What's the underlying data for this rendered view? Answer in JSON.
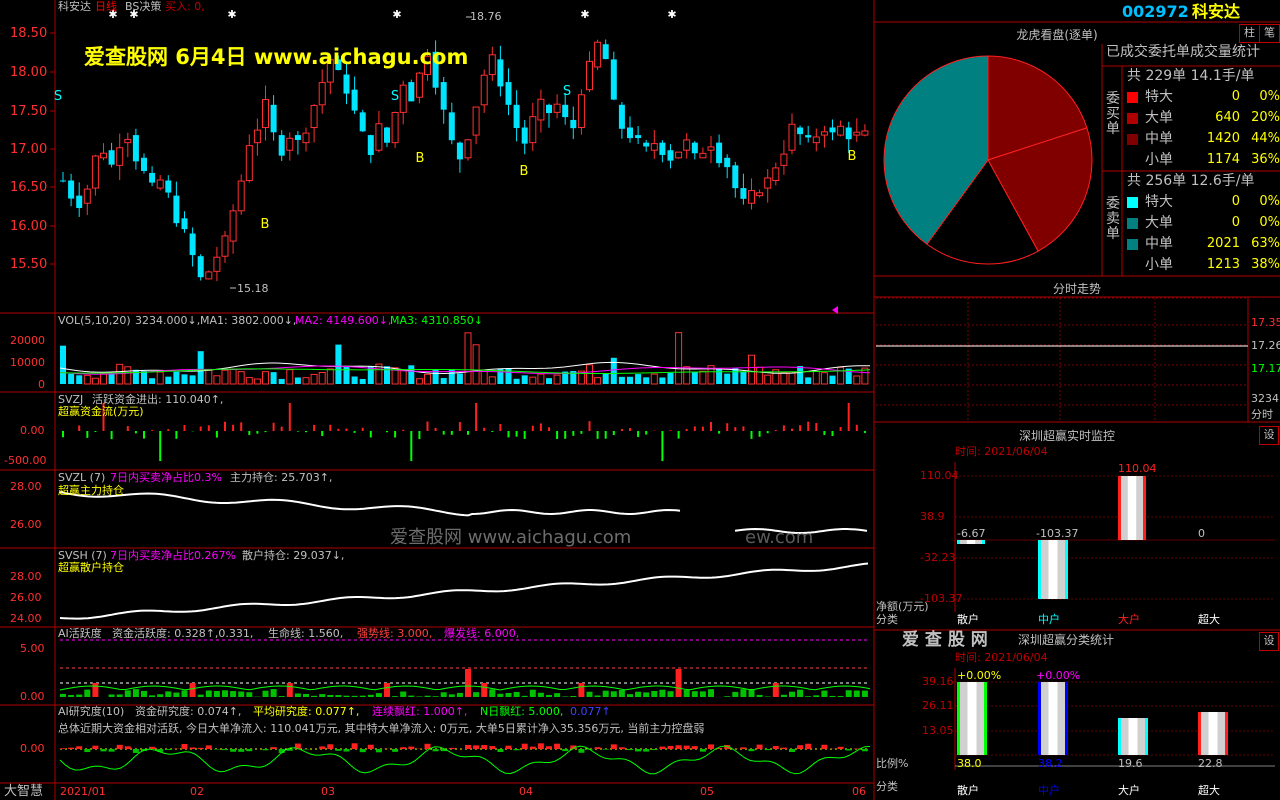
{
  "header": {
    "stock_name": "科安达",
    "period": "日线",
    "indicator": "BS决策",
    "buy_label": "买入: 0,",
    "watermark_top": "爱查股网   6月4日   www.aichagu.com",
    "watermark_mid": "爱查股网   www.aichagu.com",
    "watermark_faint": "ew.com"
  },
  "price_axis": [
    "18.50",
    "18.00",
    "17.50",
    "17.00",
    "16.50",
    "16.00",
    "15.50"
  ],
  "price_markers": {
    "high": "18.76",
    "low": "15.18"
  },
  "vol_panel": {
    "label": "VOL(5,10,20)",
    "vol": "3234.000↓,",
    "ma1": "MA1: 3802.000↓,",
    "ma2": "MA2: 4149.600↓,",
    "ma3": "MA3: 4310.850↓",
    "axis": [
      "20000",
      "10000",
      "0"
    ]
  },
  "svzj_panel": {
    "label": "SVZJ",
    "text": "活跃资金进出: 110.040↑,",
    "subtitle": "超赢资金流(万元)",
    "axis": [
      "0.00",
      "-500.00"
    ]
  },
  "svzl_panel": {
    "label": "SVZL (7)",
    "ratio": "7日内买卖净占比0.3%",
    "hold": "主力持仓: 25.703↑,",
    "subtitle": "超赢主力持仓",
    "axis": [
      "28.00",
      "26.00"
    ]
  },
  "svsh_panel": {
    "label": "SVSH (7)",
    "ratio": "7日内买卖净占比0.267%",
    "hold": "散户持仓: 29.037↓,",
    "subtitle": "超赢散户持仓",
    "axis": [
      "28.00",
      "26.00",
      "24.00"
    ]
  },
  "ai_panel": {
    "label": "AI活跃度",
    "text1": "资金活跃度: 0.328↑,0.331,",
    "text2": "生命线: 1.560,",
    "text3": "强势线: 3.000,",
    "text4": "爆发线: 6.000,",
    "axis": [
      "5.00",
      "0.00"
    ]
  },
  "research_panel": {
    "label": "AI研究度(10)",
    "text1": "资金研究度: 0.074↑,",
    "text2": "平均研究度: 0.077↑,",
    "text3": "连续飘红: 1.000↑,",
    "text4": "N日飘红: 5.000,",
    "text5": "0.077↑",
    "summary": "总体近期大资金相对活跃, 今日大单净流入: 110.041万元, 其中特大单净流入: 0万元, 大单5日累计净入35.356万元, 当前主力控盘弱",
    "axis": [
      "0.00"
    ]
  },
  "date_axis": [
    "2021/01",
    "02",
    "03",
    "04",
    "05",
    "06"
  ],
  "bottom_left": "大智慧",
  "right_panel": {
    "code": "002972",
    "name": "科安达",
    "tab1": "柱",
    "tab2": "笔",
    "title": "龙虎看盘(逐单)",
    "subtitle": "已成交委托单成交量统计",
    "buy_label": "委买单",
    "sell_label": "委卖单",
    "buy_total": "共 229单 14.1手/单",
    "sell_total": "共 256单 12.6手/单",
    "buy_rows": [
      {
        "name": "特大",
        "val": "0",
        "pct": "0%"
      },
      {
        "name": "大单",
        "val": "640",
        "pct": "20%"
      },
      {
        "name": "中单",
        "val": "1420",
        "pct": "44%"
      },
      {
        "name": "小单",
        "val": "1174",
        "pct": "36%"
      }
    ],
    "sell_rows": [
      {
        "name": "特大",
        "val": "0",
        "pct": "0%"
      },
      {
        "name": "大单",
        "val": "0",
        "pct": "0%"
      },
      {
        "name": "中单",
        "val": "2021",
        "pct": "63%"
      },
      {
        "name": "小单",
        "val": "1213",
        "pct": "38%"
      }
    ],
    "colors": {
      "buy_xl": "#ff0000",
      "buy_l": "#b00000",
      "buy_m": "#800000",
      "sell_xl": "#00ffff",
      "sell_m": "#008080"
    }
  },
  "intraday": {
    "title": "分时走势",
    "axis": [
      "17.35",
      "17.26",
      "17.17"
    ],
    "vol": "3234",
    "label": "分时"
  },
  "monitor": {
    "title": "深圳超赢实时监控",
    "set": "设",
    "time": "时间: 2021/06/04",
    "axis": [
      "110.04",
      "38.9",
      "-32.23",
      "-103.37"
    ],
    "yunit": "净额(万元)",
    "xunit": "分类",
    "labels": [
      "-6.67",
      "-103.37",
      "110.04",
      "0"
    ],
    "cats": [
      "散户",
      "中户",
      "大户",
      "超大"
    ]
  },
  "classify": {
    "title": "深圳超赢分类统计",
    "watermark": "爱 查 股 网",
    "set": "设",
    "time": "时间: 2021/06/04",
    "axis": [
      "39.16",
      "26.11",
      "13.05"
    ],
    "yunit": "比例%",
    "xunit": "分类",
    "top_labels": [
      "+0.00%",
      "+0.00%"
    ],
    "values": [
      "38.0",
      "38.2",
      "19.6",
      "22.8"
    ],
    "cats": [
      "散户",
      "中户",
      "大户",
      "超大"
    ]
  }
}
